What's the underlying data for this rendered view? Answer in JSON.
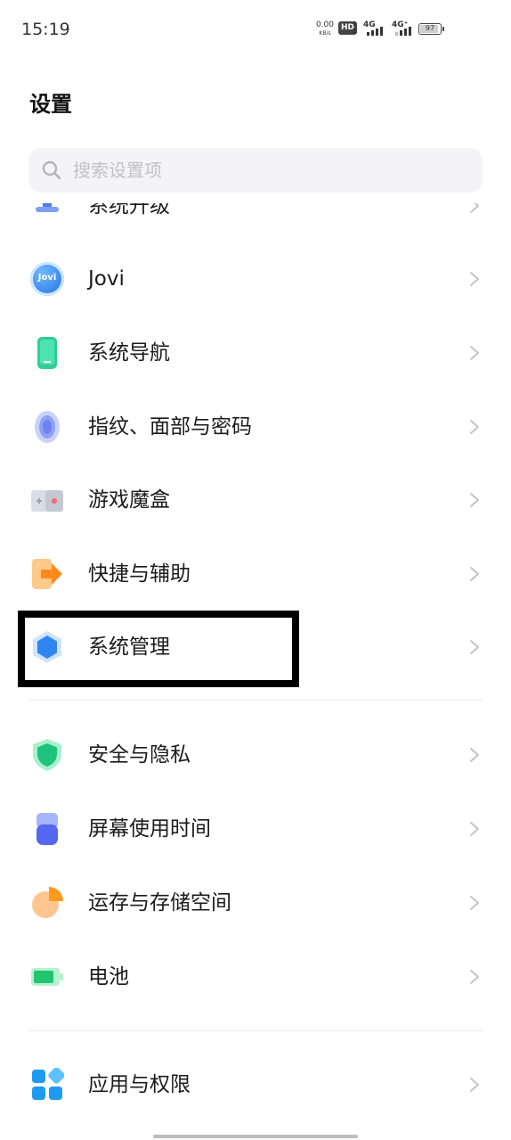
{
  "status_bar": {
    "time": "15:19",
    "net_speed_value": "0.00",
    "net_speed_unit": "KB/s",
    "hd_badge": "HD",
    "sim_numbers": "1 2",
    "sim1_network": "4G",
    "sim2_network": "4G⁺",
    "battery_percent": "97"
  },
  "header": {
    "title": "设置"
  },
  "search": {
    "placeholder": "搜索设置项",
    "value": ""
  },
  "settings_items": [
    {
      "label": "系统升级",
      "icon": "system-update-icon"
    },
    {
      "label": "Jovi",
      "icon": "jovi-icon",
      "icon_text": "Jovi"
    },
    {
      "label": "系统导航",
      "icon": "navigation-icon"
    },
    {
      "label": "指纹、面部与密码",
      "icon": "fingerprint-icon"
    },
    {
      "label": "游戏魔盒",
      "icon": "game-box-icon"
    },
    {
      "label": "快捷与辅助",
      "icon": "shortcut-icon"
    },
    {
      "label": "系统管理",
      "icon": "system-management-icon",
      "highlighted": true
    },
    {
      "label": "安全与隐私",
      "icon": "shield-icon"
    },
    {
      "label": "屏幕使用时间",
      "icon": "screen-time-icon"
    },
    {
      "label": "运存与存储空间",
      "icon": "storage-icon"
    },
    {
      "label": "电池",
      "icon": "battery-icon"
    },
    {
      "label": "应用与权限",
      "icon": "apps-icon"
    }
  ],
  "colors": {
    "highlight_border": "#000000",
    "chevron": "#c4c4c4",
    "search_bg": "#f4f4f6"
  }
}
